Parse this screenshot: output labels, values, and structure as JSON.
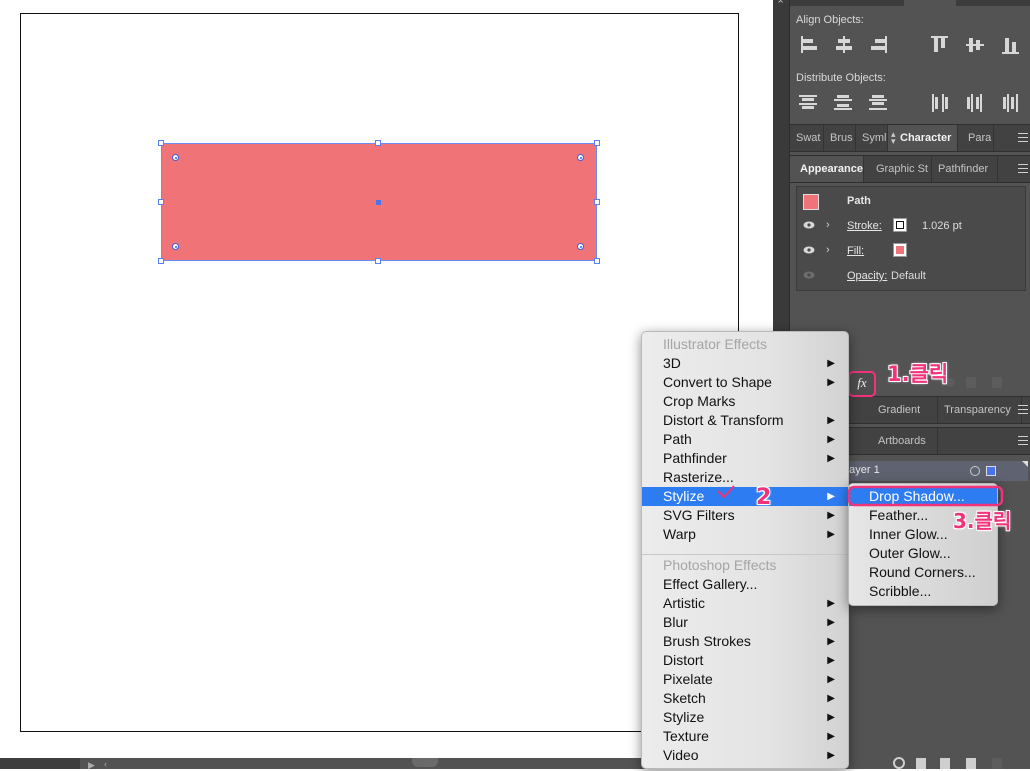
{
  "align_panel": {
    "align_objects_label": "Align Objects:",
    "distribute_objects_label": "Distribute Objects:"
  },
  "character_tabs": [
    "Swat",
    "Brus",
    "Syml",
    "Character",
    "Para"
  ],
  "appearance_tabs": [
    "Appearance",
    "Graphic St",
    "Pathfinder"
  ],
  "appearance": {
    "object_type": "Path",
    "stroke_label": "Stroke:",
    "stroke_weight": "1.026 pt",
    "fill_label": "Fill:",
    "opacity_label": "Opacity:",
    "opacity_value": "Default",
    "fill_color": "#f07377"
  },
  "fx_button": {
    "label": "fx"
  },
  "gradient_tabs": [
    "Gradient",
    "Transparency"
  ],
  "layers_tabs": [
    "Artboards"
  ],
  "layers": {
    "layer_name": "Layer 1"
  },
  "effect_menu": {
    "illustrator_header": "Illustrator Effects",
    "illustrator_items": [
      {
        "label": "3D",
        "has_sub": true
      },
      {
        "label": "Convert to Shape",
        "has_sub": true
      },
      {
        "label": "Crop Marks",
        "has_sub": false
      },
      {
        "label": "Distort & Transform",
        "has_sub": true
      },
      {
        "label": "Path",
        "has_sub": true
      },
      {
        "label": "Pathfinder",
        "has_sub": true
      },
      {
        "label": "Rasterize...",
        "has_sub": false
      },
      {
        "label": "Stylize",
        "has_sub": true
      },
      {
        "label": "SVG Filters",
        "has_sub": true
      },
      {
        "label": "Warp",
        "has_sub": true
      }
    ],
    "photoshop_header": "Photoshop Effects",
    "photoshop_items": [
      {
        "label": "Effect Gallery...",
        "has_sub": false
      },
      {
        "label": "Artistic",
        "has_sub": true
      },
      {
        "label": "Blur",
        "has_sub": true
      },
      {
        "label": "Brush Strokes",
        "has_sub": true
      },
      {
        "label": "Distort",
        "has_sub": true
      },
      {
        "label": "Pixelate",
        "has_sub": true
      },
      {
        "label": "Sketch",
        "has_sub": true
      },
      {
        "label": "Stylize",
        "has_sub": true
      },
      {
        "label": "Texture",
        "has_sub": true
      },
      {
        "label": "Video",
        "has_sub": true
      }
    ]
  },
  "stylize_submenu": [
    "Drop Shadow...",
    "Feather...",
    "Inner Glow...",
    "Outer Glow...",
    "Round Corners...",
    "Scribble..."
  ],
  "annotations": {
    "step1": "1.클릭",
    "step2": "2",
    "step3": "3.클릭",
    "color": "#f0337a"
  },
  "colors": {
    "shape_fill": "#f07377",
    "selection": "#4a73ee",
    "menu_highlight": "#2e7cf2",
    "panel_bg": "#535353"
  }
}
